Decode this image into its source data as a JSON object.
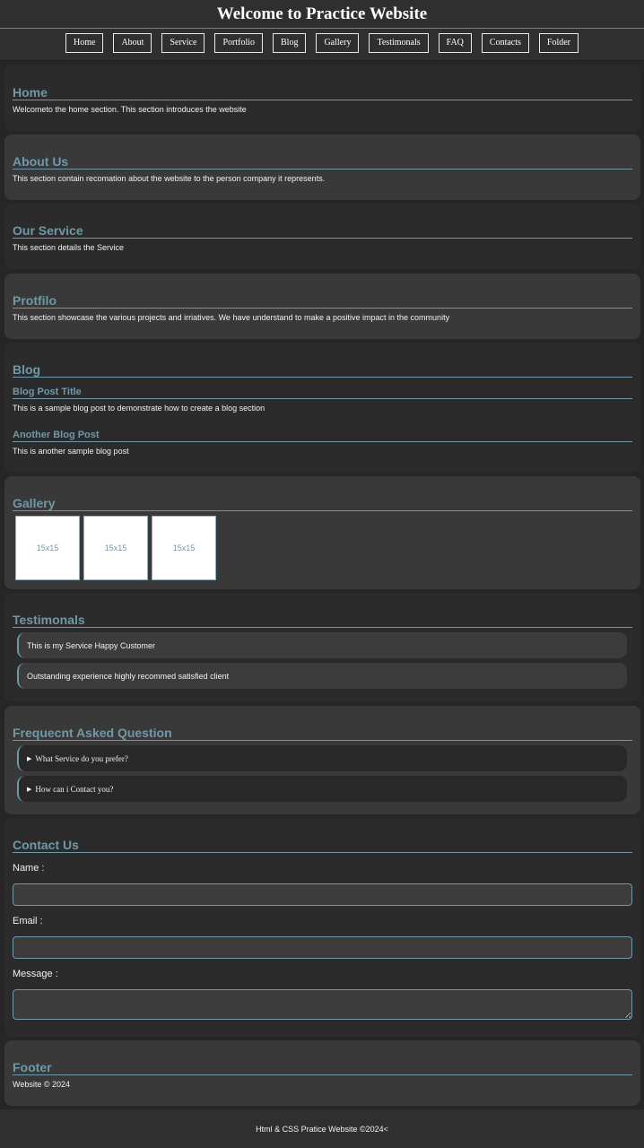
{
  "header": {
    "title": "Welcome to Practice Website",
    "nav": [
      "Home",
      "About",
      "Service",
      "Portfolio",
      "Blog",
      "Gallery",
      "Testimonals",
      "FAQ",
      "Contacts",
      "Folder"
    ]
  },
  "sections": {
    "home": {
      "title": "Home",
      "text": "Welcometo the home section. This section introduces the website"
    },
    "about": {
      "title": "About Us",
      "text": "This section contain recomation about the website to the person company it represents."
    },
    "service": {
      "title": "Our Service",
      "text": "This section details the Service"
    },
    "portfolio": {
      "title": "Protfilo",
      "text": "This section showcase the various projects and irriatives. We have understand to make a positive impact in the community"
    },
    "blog": {
      "title": "Blog",
      "posts": [
        {
          "title": "Blog Post Title",
          "text": "This is a sample blog post to demonstrate how to create a blog section"
        },
        {
          "title": "Another Blog Post",
          "text": "This is another sample blog post"
        }
      ]
    },
    "gallery": {
      "title": "Gallery",
      "images": [
        "15x15",
        "15x15",
        "15x15"
      ]
    },
    "testimonials": {
      "title": "Testimonals",
      "items": [
        "This is my Service Happy Customer",
        "Outstanding experience highly recommed satisfied client"
      ]
    },
    "faq": {
      "title": "Frequecnt Asked Question",
      "items": [
        "What Service do you prefer?",
        "How can i Contact you?"
      ]
    },
    "contact": {
      "title": "Contact Us",
      "name_label": "Name :",
      "email_label": "Email :",
      "message_label": "Message :",
      "name_value": "",
      "email_value": "",
      "message_value": ""
    },
    "footer_section": {
      "title": "Footer",
      "text": "Website © 2024"
    }
  },
  "page_footer": {
    "text": "Html & CSS Pratice Website ©2024<"
  },
  "colors": {
    "accent": "#6f98a8",
    "background": "#262626",
    "panel_dark": "#2b2b2b",
    "panel_light": "#393939"
  }
}
